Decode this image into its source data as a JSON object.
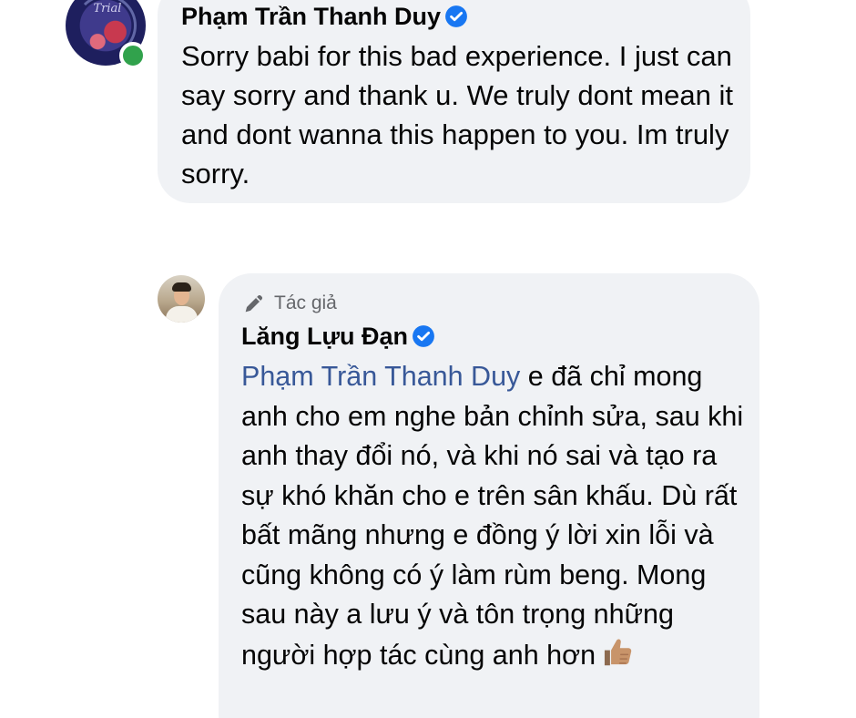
{
  "comments": [
    {
      "author": "Phạm Trần Thanh Duy",
      "verified": true,
      "online": true,
      "avatar_text": "Delulu Trial",
      "text": "Sorry babi for this bad experience. I just can say sorry and thank u. We truly dont mean it and dont wanna this happen to you. Im truly sorry."
    },
    {
      "badge_label": "Tác giả",
      "badge_icon": "pencil-icon",
      "author": "Lăng Lựu Đạn",
      "verified": true,
      "mention": "Phạm Trần Thanh Duy",
      "text": " e đã chỉ mong anh cho em nghe bản chỉnh sửa, sau khi anh thay đổi nó, và khi nó sai và tạo ra sự khó khăn cho e trên sân khấu. Dù rất bất mãng nhưng e đồng ý lời xin lỗi và cũng không có ý làm rùm beng. Mong sau này a lưu ý và tôn trọng những người hợp tác cùng anh hơn",
      "emoji": "thumbs-up"
    }
  ],
  "colors": {
    "bubble": "#f0f2f5",
    "mention": "#385898",
    "verified": "#1877f2",
    "online": "#31a24c",
    "meta": "#65676b"
  }
}
